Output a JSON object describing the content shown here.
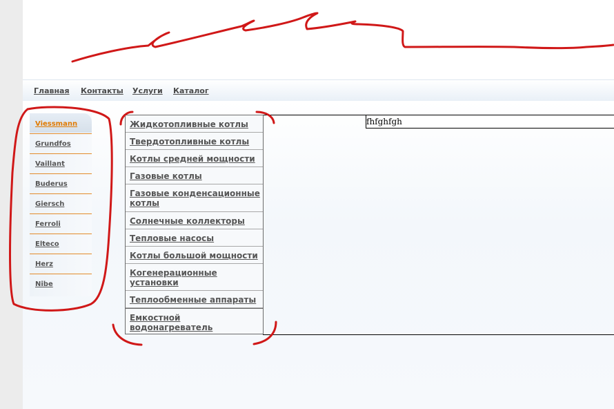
{
  "nav": {
    "items": [
      "Главная",
      "Контакты",
      "Услуги",
      "Каталог"
    ]
  },
  "brands": {
    "active": "Viessmann",
    "items": [
      "Viessmann",
      "Grundfos",
      "Vaillant",
      "Buderus",
      "Giersch",
      "Ferroli",
      "Elteco",
      "Herz",
      "Nibe"
    ]
  },
  "categories": [
    "Жидкотопливные котлы",
    "Твердотопливные котлы",
    "Котлы средней мощности",
    "Газовые котлы",
    "Газовые конденсационные котлы",
    "Солнечные коллекторы",
    "Тепловые насосы",
    "Котлы большой мощности",
    "Когенерационные установки",
    "Теплообменные аппараты",
    "Емкостной водонагреватель"
  ],
  "content": {
    "text": "fhfghfgh"
  },
  "colors": {
    "accent": "#e07a00",
    "annotation": "#d01818"
  }
}
